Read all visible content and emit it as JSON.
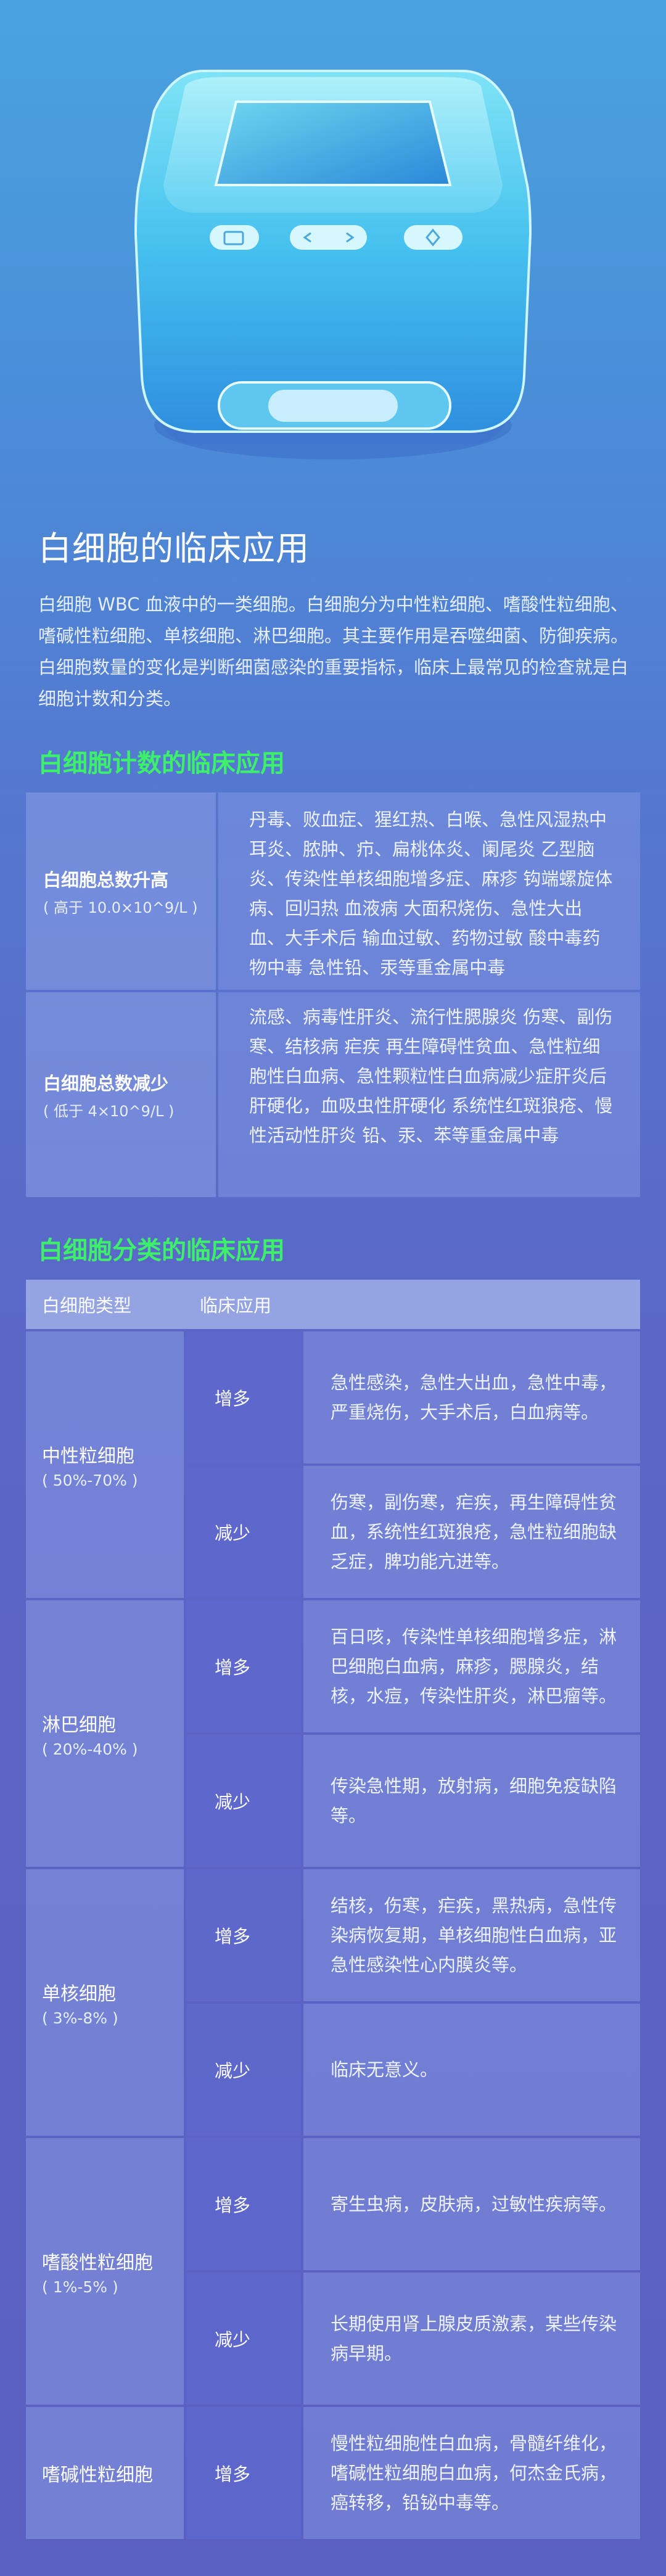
{
  "intro": {
    "title": "白细胞的临床应用",
    "text": "白细胞 WBC 血液中的一类细胞。白细胞分为中性粒细胞、嗜酸性粒细胞、嗜碱性粒细胞、单核细胞、淋巴细胞。其主要作用是吞噬细菌、防御疾病。白细胞数量的变化是判断细菌感染的重要指标，临床上最常见的检查就是白细胞计数和分类。"
  },
  "count_section": {
    "title": "白细胞计数的临床应用",
    "rows": [
      {
        "label": "白细胞总数升高",
        "sub": "( 高于 10.0×10^9/L )",
        "text": "丹毒、败血症、猩红热、白喉、急性风湿热中耳炎、脓肿、疖、扁桃体炎、阑尾炎 乙型脑炎、传染性单核细胞增多症、麻疹 钩端螺旋体病、回归热 血液病 大面积烧伤、急性大出血、大手术后 输血过敏、药物过敏 酸中毒药物中毒 急性铅、汞等重金属中毒"
      },
      {
        "label": "白细胞总数减少",
        "sub": "( 低于 4×10^9/L )",
        "text": "流感、病毒性肝炎、流行性腮腺炎 伤寒、副伤寒、结核病 疟疾 再生障碍性贫血、急性粒细胞性白血病、急性颗粒性白血病减少症肝炎后肝硬化，血吸虫性肝硬化 系统性红斑狼疮、慢性活动性肝炎 铅、汞、苯等重金属中毒"
      }
    ]
  },
  "class_section": {
    "title": "白细胞分类的临床应用",
    "header": {
      "type": "白细胞类型",
      "use": "临床应用"
    },
    "groups": [
      {
        "name": "中性粒细胞",
        "range": "( 50%-70% )",
        "rows": [
          {
            "label": "增多",
            "text": "急性感染，急性大出血，急性中毒，严重烧伤，大手术后，白血病等。"
          },
          {
            "label": "减少",
            "text": "伤寒，副伤寒，疟疾，再生障碍性贫血，系统性红斑狼疮，急性粒细胞缺乏症，脾功能亢进等。"
          }
        ]
      },
      {
        "name": "淋巴细胞",
        "range": "( 20%-40% )",
        "rows": [
          {
            "label": "增多",
            "text": "百日咳，传染性单核细胞增多症，淋巴细胞白血病，麻疹，腮腺炎，结核，水痘，传染性肝炎，淋巴瘤等。"
          },
          {
            "label": "减少",
            "text": "传染急性期，放射病，细胞免疫缺陷等。"
          }
        ]
      },
      {
        "name": "单核细胞",
        "range": "( 3%-8% )",
        "rows": [
          {
            "label": "增多",
            "text": "结核，伤寒，疟疾，黑热病，急性传染病恢复期，单核细胞性白血病，亚急性感染性心内膜炎等。"
          },
          {
            "label": "减少",
            "text": "临床无意义。"
          }
        ]
      },
      {
        "name": "嗜酸性粒细胞",
        "range": "( 1%-5% )",
        "rows": [
          {
            "label": "增多",
            "text": "寄生虫病，皮肤病，过敏性疾病等。"
          },
          {
            "label": "减少",
            "text": "长期使用肾上腺皮质激素，某些传染病早期。"
          }
        ]
      },
      {
        "name": "嗜碱性粒细胞",
        "range": "",
        "rows": [
          {
            "label": "增多",
            "text": "慢性粒细胞性白血病，骨髓纤维化，嗜碱性粒细胞白血病，何杰金氏病，癌转移，铅铋中毒等。"
          }
        ]
      }
    ]
  }
}
